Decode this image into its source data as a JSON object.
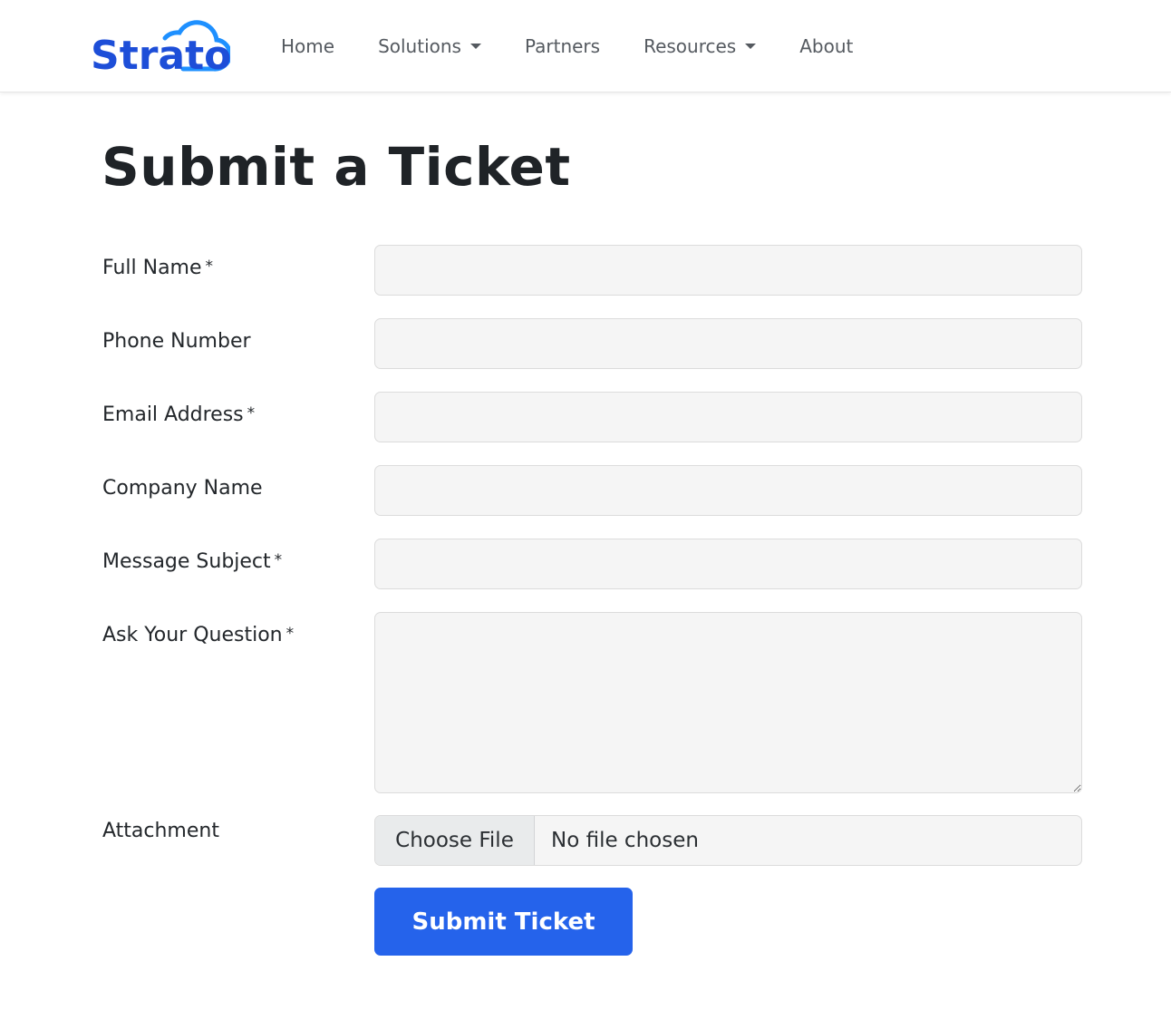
{
  "brand": {
    "logo_text": "Strato",
    "logo_color": "#1d4ed8",
    "cloud_color": "#1e90ff"
  },
  "nav": {
    "items": [
      {
        "label": "Home",
        "dropdown": false
      },
      {
        "label": "Solutions",
        "dropdown": true
      },
      {
        "label": "Partners",
        "dropdown": false
      },
      {
        "label": "Resources",
        "dropdown": true
      },
      {
        "label": "About",
        "dropdown": false
      }
    ]
  },
  "page": {
    "title": "Submit a Ticket"
  },
  "form": {
    "required_marker": "*",
    "fields": [
      {
        "label": "Full Name",
        "required": true,
        "value": ""
      },
      {
        "label": "Phone Number",
        "required": false,
        "value": ""
      },
      {
        "label": "Email Address",
        "required": true,
        "value": ""
      },
      {
        "label": "Company Name",
        "required": false,
        "value": ""
      },
      {
        "label": "Message Subject",
        "required": true,
        "value": ""
      },
      {
        "label": "Ask Your Question",
        "required": true,
        "value": ""
      }
    ],
    "attachment": {
      "label": "Attachment",
      "button_label": "Choose File",
      "status": "No file chosen"
    },
    "submit_label": "Submit Ticket",
    "submit_color": "#2563eb"
  }
}
